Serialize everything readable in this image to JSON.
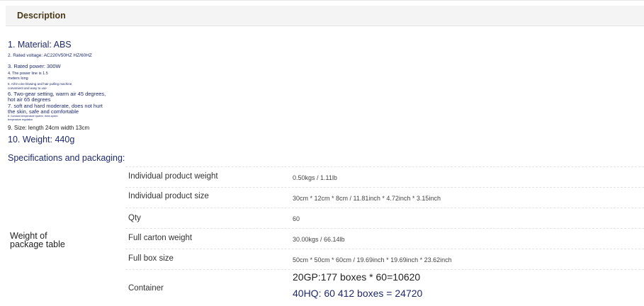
{
  "header": {
    "title": "Description"
  },
  "description": {
    "lines": [
      "1. Material: ABS",
      "2. Rated voltage: AC220V50HZ HZ/60HZ",
      "3. Rated power: 300W",
      "4. The power line is 1.5",
      "meters long",
      "5. All-in-one blowing and hair pulling machine,",
      "convenient and easy to use",
      "6. Two-gear setting, warm air 45 degrees,",
      "hot air 65 degrees",
      "7. soft and hard moderate, does not hurt",
      "the skin, safe and comfortable",
      "8. Constant temperature system, three-speed",
      "temperature regulation",
      "9. Size: length 24cm width 13cm",
      "10. Weight: 440g"
    ],
    "specs_title": "Specifications and packaging:"
  },
  "package_table": {
    "side_label_line1": "Weight of",
    "side_label_line2": "package table",
    "rows": [
      {
        "label": "Individual product weight",
        "value": "0.50kgs / 1.11lb"
      },
      {
        "label": "Individual product size",
        "value": "30cm * 12cm * 8cm / 11.81inch * 4.72inch * 3.15inch"
      },
      {
        "label": "Qty",
        "value": "60"
      },
      {
        "label": "Full carton weight",
        "value": "30.00kgs / 66.14lb"
      },
      {
        "label": "Full box size",
        "value": "50cm * 50cm * 60cm / 19.69inch * 19.69inch * 23.62inch"
      },
      {
        "label": "Container",
        "value_line1": "20GP:177 boxes * 60=10620",
        "value_line2": "40HQ: 60 412 boxes = 24720"
      }
    ]
  },
  "colors": {
    "navy": "#1e2a6e",
    "header_bg": "#f4f4f4"
  }
}
